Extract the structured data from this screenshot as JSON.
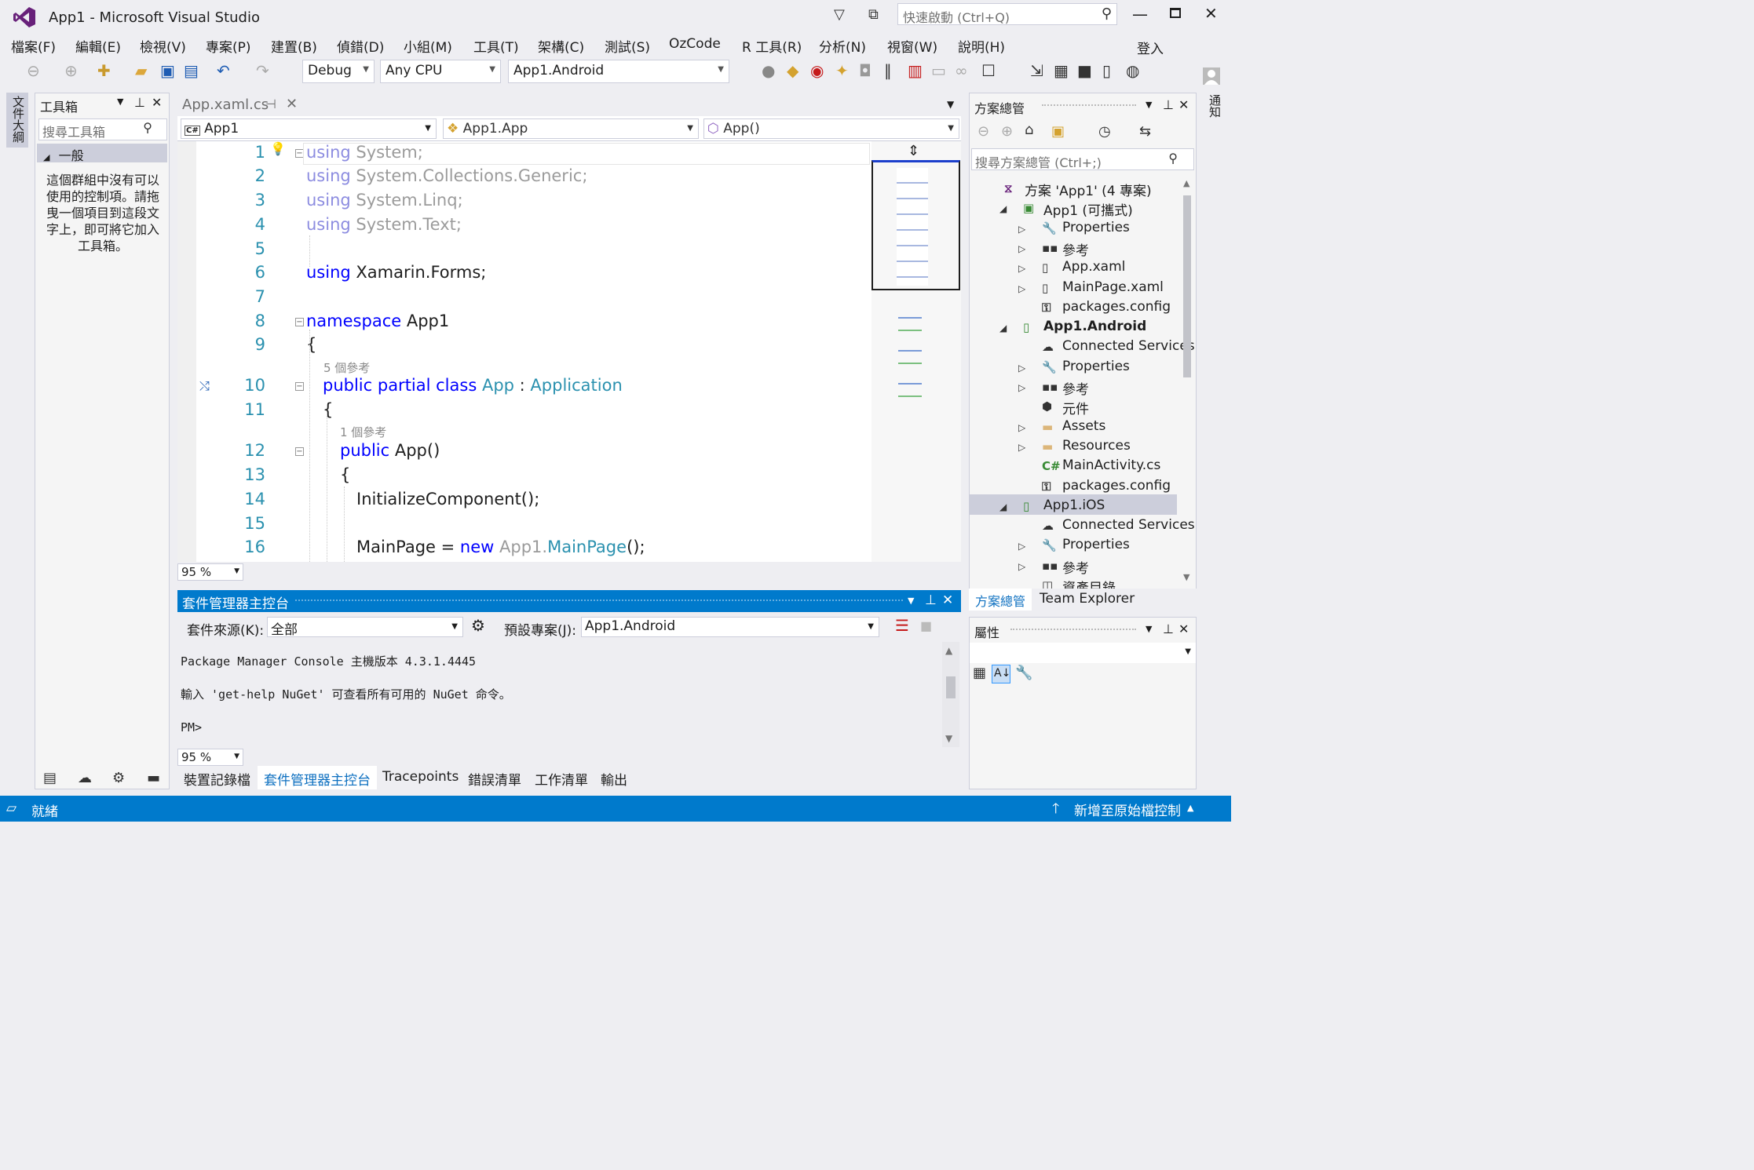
{
  "window": {
    "title": "App1 - Microsoft Visual Studio",
    "quick_launch_placeholder": "快速啟動 (Ctrl+Q)",
    "signin": "登入"
  },
  "menu": [
    "檔案(F)",
    "編輯(E)",
    "檢視(V)",
    "專案(P)",
    "建置(B)",
    "偵錯(D)",
    "小組(M)",
    "工具(T)",
    "架構(C)",
    "測試(S)",
    "OzCode",
    "R 工具(R)",
    "分析(N)",
    "視窗(W)",
    "說明(H)"
  ],
  "toolbar": {
    "config": "Debug",
    "platform": "Any CPU",
    "startup": "App1.Android"
  },
  "left_strip": {
    "label": "文件大綱"
  },
  "right_strip": {
    "label": "通知"
  },
  "toolbox": {
    "title": "工具箱",
    "search_placeholder": "搜尋工具箱",
    "group": "一般",
    "empty_text": "這個群組中沒有可以使用的控制項。請拖曳一個項目到這段文字上，即可將它加入工具箱。"
  },
  "editor": {
    "tab": "App.xaml.cs",
    "nav_project": "App1",
    "nav_class": "App1.App",
    "nav_member": "App()",
    "zoom": "95 %",
    "lines": [
      {
        "n": "1",
        "code": [
          {
            "t": "using System;",
            "c": "dim-kw"
          }
        ]
      },
      {
        "n": "2",
        "code": [
          {
            "t": "using System.Collections.Generic;",
            "c": "dim-kw"
          }
        ]
      },
      {
        "n": "3",
        "code": [
          {
            "t": "using System.Linq;",
            "c": "dim-kw"
          }
        ]
      },
      {
        "n": "4",
        "code": [
          {
            "t": "using System.Text;",
            "c": "dim-kw"
          }
        ]
      },
      {
        "n": "5",
        "code": []
      },
      {
        "n": "6",
        "code": [
          {
            "t": "using",
            "c": "kw"
          },
          {
            "t": " Xamarin.Forms;",
            "c": ""
          }
        ]
      },
      {
        "n": "7",
        "code": []
      },
      {
        "n": "8",
        "code": [
          {
            "t": "namespace",
            "c": "kw"
          },
          {
            "t": " App1",
            "c": ""
          }
        ]
      },
      {
        "n": "9",
        "code": [
          {
            "t": "{",
            "c": ""
          }
        ]
      },
      {
        "n": "10",
        "code": [
          {
            "t": "public partial class",
            "c": "kw"
          },
          {
            "t": " App",
            "c": "ty"
          },
          {
            "t": " : ",
            "c": ""
          },
          {
            "t": "Application",
            "c": "ty"
          }
        ]
      },
      {
        "n": "11",
        "code": [
          {
            "t": "{",
            "c": ""
          }
        ]
      },
      {
        "n": "12",
        "code": [
          {
            "t": "public",
            "c": "kw"
          },
          {
            "t": " App()",
            "c": ""
          }
        ]
      },
      {
        "n": "13",
        "code": [
          {
            "t": "{",
            "c": ""
          }
        ]
      },
      {
        "n": "14",
        "code": [
          {
            "t": "InitializeComponent();",
            "c": ""
          }
        ]
      },
      {
        "n": "15",
        "code": []
      },
      {
        "n": "16",
        "code": [
          {
            "t": "MainPage = ",
            "c": ""
          },
          {
            "t": "new",
            "c": "kw"
          },
          {
            "t": " App1.",
            "c": "dimplain"
          },
          {
            "t": "MainPage",
            "c": "ty"
          },
          {
            "t": "();",
            "c": ""
          }
        ]
      }
    ],
    "refs": {
      "class_refs": "5 個參考",
      "ctor_refs": "1 個參考"
    }
  },
  "pmc": {
    "title": "套件管理器主控台",
    "source_label": "套件來源(K):",
    "source_value": "全部",
    "default_project_label": "預設專案(J):",
    "default_project_value": "App1.Android",
    "output_line1": "Package Manager Console 主機版本 4.3.1.4445",
    "output_line2": "輸入 'get-help NuGet' 可查看所有可用的 NuGet 命令。",
    "prompt": "PM>",
    "zoom": "95 %"
  },
  "bottom_tabs": [
    "裝置記錄檔",
    "套件管理器主控台",
    "Tracepoints",
    "錯誤清單",
    "工作清單",
    "輸出"
  ],
  "solution_explorer": {
    "title": "方案總管",
    "search_placeholder": "搜尋方案總管 (Ctrl+;)",
    "items": [
      {
        "label": "方案 'App1' (4 專案)",
        "icon": "solution-icon"
      },
      {
        "label": "App1 (可攜式)",
        "icon": "csharp-project-icon"
      },
      {
        "label": "Properties",
        "icon": "wrench-icon"
      },
      {
        "label": "參考",
        "icon": "references-icon"
      },
      {
        "label": "App.xaml",
        "icon": "xaml-file-icon"
      },
      {
        "label": "MainPage.xaml",
        "icon": "xaml-file-icon"
      },
      {
        "label": "packages.config",
        "icon": "config-file-icon"
      },
      {
        "label": "App1.Android",
        "icon": "android-project-icon"
      },
      {
        "label": "Connected Services",
        "icon": "cloud-icon"
      },
      {
        "label": "Properties",
        "icon": "wrench-icon"
      },
      {
        "label": "參考",
        "icon": "references-icon"
      },
      {
        "label": "元件",
        "icon": "component-icon"
      },
      {
        "label": "Assets",
        "icon": "folder-icon"
      },
      {
        "label": "Resources",
        "icon": "folder-icon"
      },
      {
        "label": "MainActivity.cs",
        "icon": "csharp-file-icon"
      },
      {
        "label": "packages.config",
        "icon": "config-file-icon"
      },
      {
        "label": "App1.iOS",
        "icon": "ios-project-icon"
      },
      {
        "label": "Connected Services",
        "icon": "cloud-icon"
      },
      {
        "label": "Properties",
        "icon": "wrench-icon"
      },
      {
        "label": "參考",
        "icon": "references-icon"
      },
      {
        "label": "資產目錄",
        "icon": "catalog-icon"
      }
    ],
    "tabs": [
      "方案總管",
      "Team Explorer"
    ]
  },
  "properties": {
    "title": "屬性"
  },
  "status": {
    "text": "就緒",
    "source_control": "新增至原始檔控制"
  },
  "colors": {
    "accent": "#007ACC",
    "status_bg": "#007ACC",
    "vs_purple": "#68217A"
  }
}
